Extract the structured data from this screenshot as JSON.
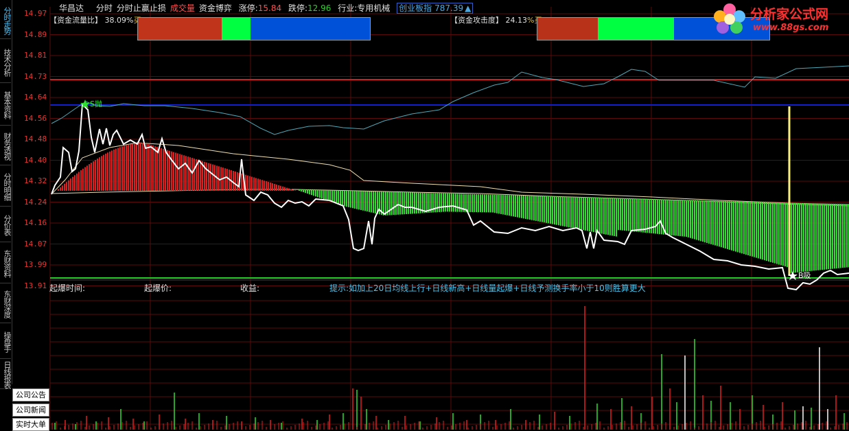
{
  "sidebar": {
    "tabs": [
      {
        "label": "分时走势",
        "active": true
      },
      {
        "label": "技术分析",
        "active": false
      },
      {
        "label": "基本资料",
        "active": false
      },
      {
        "label": "财务透视",
        "active": false
      },
      {
        "label": "分时明细",
        "active": false
      },
      {
        "label": "分价表",
        "active": false
      },
      {
        "label": "东财资料",
        "active": false
      },
      {
        "label": "东财深度",
        "active": false
      },
      {
        "label": "操盘手",
        "active": false
      },
      {
        "label": "日线报表",
        "active": false
      }
    ],
    "bottom_buttons": [
      "公司公告",
      "公司新闻",
      "实时大单"
    ]
  },
  "header": {
    "stock_name": "华昌达",
    "items": [
      {
        "text": "分时",
        "color": "#e0e0e0"
      },
      {
        "text": "分时止赢止损",
        "color": "#e0e0e0"
      },
      {
        "text": "成交量",
        "color": "#ff5050"
      },
      {
        "text": "资金博弈",
        "color": "#e0e0e0"
      }
    ],
    "limit_up_label": "涨停:",
    "limit_up": "15.84",
    "limit_down_label": "跌停:",
    "limit_down": "12.96",
    "industry_label": "行业:",
    "industry": "专用机械",
    "index_name": "创业板指",
    "index_value": "787.39",
    "index_arrow": "▲"
  },
  "price_axis": [
    "14.97",
    "14.89",
    "14.81",
    "14.73",
    "14.64",
    "14.56",
    "14.48",
    "14.40",
    "14.32",
    "14.24",
    "14.16",
    "14.07",
    "13.99",
    "13.91"
  ],
  "fund_flow": {
    "label": "【资金流量比】",
    "value": "38.09%",
    "suffix": "买",
    "segments": [
      {
        "share": 0.36,
        "color": "#c0341b"
      },
      {
        "share": 0.125,
        "color": "#00ff40"
      },
      {
        "share": 0.515,
        "color": "#0050d8"
      }
    ]
  },
  "fund_attack": {
    "label": "【资金攻击度】",
    "value": "24.13",
    "suffix": "%买",
    "segments": [
      {
        "share": 0.26,
        "color": "#b8321a"
      },
      {
        "share": 0.33,
        "color": "#00ff40"
      },
      {
        "share": 0.41,
        "color": "#0050d8"
      }
    ]
  },
  "markers": {
    "sell": "S抛",
    "buy": "B吸"
  },
  "subchart": {
    "burst_time_label": "起爆时间:",
    "burst_price_label": "起爆价:",
    "profit_label": "收益:",
    "tip": "提示:如加上20日均线上行+日线新高+日线量起爆+日线予测换手率小于10则胜算更大"
  },
  "logo": {
    "title": "分析家公式网",
    "url": "www.88gs.com"
  },
  "colors": {
    "price_line": "#ffffff",
    "avg_line": "#4fa8b8",
    "ma_line": "#f0e0b0",
    "red_bars": "#e02020",
    "green_bars": "#30e030",
    "ref_red_line": "#cc2020",
    "ref_blue_line": "#1020d0",
    "ref_green_line": "#20d020",
    "marker_line": "#f8f080"
  }
}
